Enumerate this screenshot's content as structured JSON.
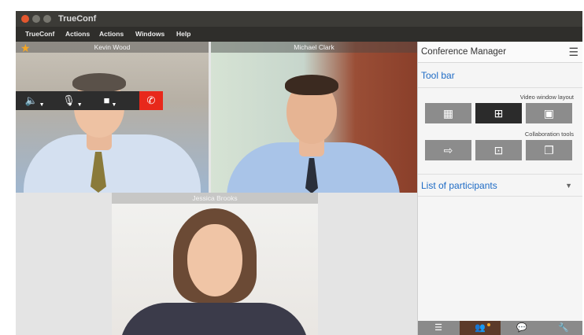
{
  "app": {
    "title": "TrueConf",
    "menu": [
      "TrueConf",
      "Actions",
      "Actions",
      "Windows",
      "Help"
    ]
  },
  "videos": [
    {
      "participant": "Kevin Wood"
    },
    {
      "participant": "Michael Clark"
    },
    {
      "participant": "Jessica Brooks"
    }
  ],
  "controls": {
    "icons": [
      "speaker-icon",
      "microphone-icon",
      "camera-icon",
      "hangup-icon"
    ]
  },
  "conference_manager": {
    "title": "Conference Manager",
    "toolbar_title": "Tool bar",
    "video_layout_label": "Video window layout",
    "collaboration_label": "Collaboration tools",
    "participants_title": "List of participants"
  },
  "colors": {
    "accent_blue": "#1e6bc5",
    "hangup_red": "#e8281b",
    "star_orange": "#f5a623"
  }
}
